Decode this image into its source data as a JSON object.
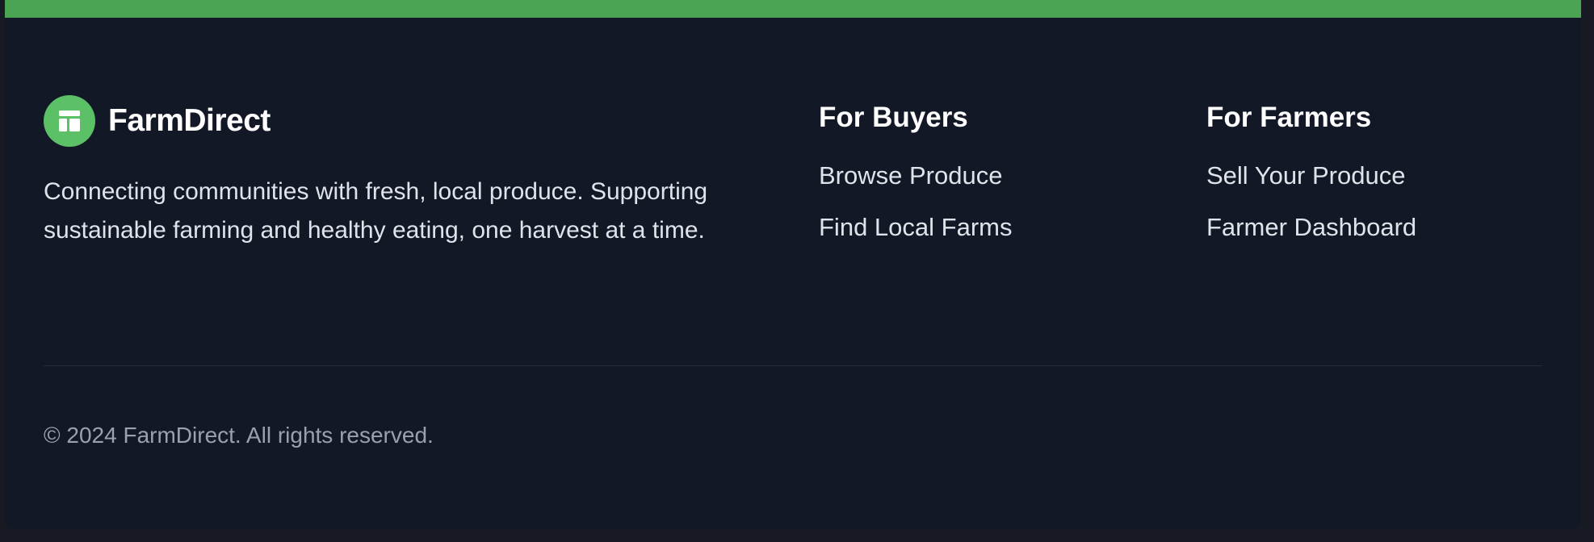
{
  "colors": {
    "accent_bar": "#4ba454",
    "logo_bg": "#5cc067",
    "background": "#131827"
  },
  "brand": {
    "name": "FarmDirect",
    "icon": "layout-icon",
    "tagline": "Connecting communities with fresh, local produce. Supporting sustainable farming and healthy eating, one harvest at a time."
  },
  "buyers": {
    "heading": "For Buyers",
    "links": [
      "Browse Produce",
      "Find Local Farms"
    ]
  },
  "farmers": {
    "heading": "For Farmers",
    "links": [
      "Sell Your Produce",
      "Farmer Dashboard"
    ]
  },
  "copyright": "© 2024 FarmDirect. All rights reserved."
}
